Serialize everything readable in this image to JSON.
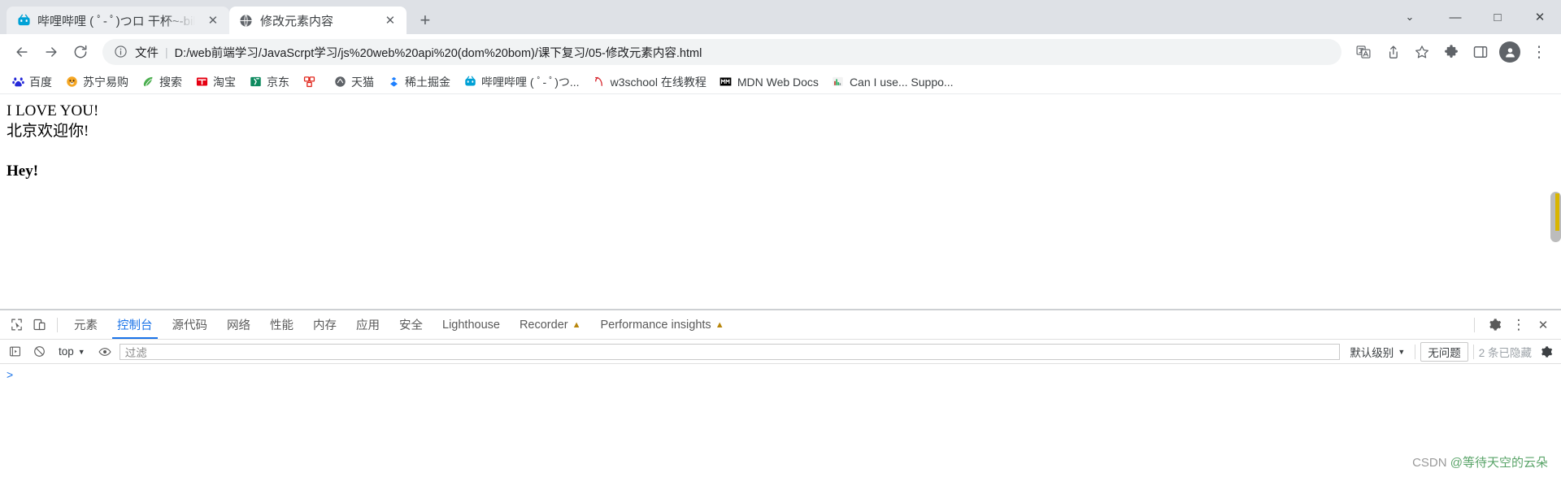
{
  "browser": {
    "tabs": [
      {
        "title": "哔哩哔哩 ( ﾟ- ﾟ)つロ 干杯~-bili",
        "favicon": "bilibili-icon",
        "active": false,
        "close_label": "✕"
      },
      {
        "title": "修改元素内容",
        "favicon": "globe-icon",
        "active": true,
        "close_label": "✕"
      }
    ],
    "new_tab_label": "+",
    "window_controls": {
      "chevron_label": "⌄",
      "minimize_label": "—",
      "maximize_label": "□",
      "close_label": "✕"
    },
    "toolbar": {
      "back_label": "←",
      "forward_label": "→",
      "reload_label": "⟳",
      "scheme_label": "文件",
      "separator": "|",
      "url": "D:/web前端学习/JavaScrpt学习/js%20web%20api%20(dom%20bom)/课下复习/05-修改元素内容.html",
      "translate_label": "translate-icon",
      "share_label": "share-icon",
      "bookmark_label": "star-icon",
      "extensions_label": "puzzle-icon",
      "sidepanel_label": "sidepanel-icon",
      "profile_label": "avatar",
      "menu_label": "⋮"
    },
    "bookmarks": [
      {
        "label": "百度",
        "icon": "baidu-icon"
      },
      {
        "label": "苏宁易购",
        "icon": "suning-icon"
      },
      {
        "label": "搜索",
        "icon": "sogou-icon"
      },
      {
        "label": "淘宝",
        "icon": "taobao-icon"
      },
      {
        "label": "京东",
        "icon": "jd-icon"
      },
      {
        "label": "",
        "icon": "pinpin-icon"
      },
      {
        "label": "天猫",
        "icon": "tmall-icon"
      },
      {
        "label": "稀土掘金",
        "icon": "juejin-icon"
      },
      {
        "label": "哔哩哔哩 ( ﾟ- ﾟ)つ...",
        "icon": "bilibili-icon"
      },
      {
        "label": "w3school 在线教程",
        "icon": "w3school-icon"
      },
      {
        "label": "MDN Web Docs",
        "icon": "mdn-icon"
      },
      {
        "label": "Can I use... Suppo...",
        "icon": "caniuse-icon"
      }
    ]
  },
  "page": {
    "line1": "I LOVE YOU!",
    "line2": "北京欢迎你!",
    "heading": "Hey!"
  },
  "devtools": {
    "inspect_icon": "inspect-icon",
    "device_icon": "device-toolbar-icon",
    "tabs": [
      {
        "label": "元素",
        "selected": false,
        "warn": false
      },
      {
        "label": "控制台",
        "selected": true,
        "warn": false
      },
      {
        "label": "源代码",
        "selected": false,
        "warn": false
      },
      {
        "label": "网络",
        "selected": false,
        "warn": false
      },
      {
        "label": "性能",
        "selected": false,
        "warn": false
      },
      {
        "label": "内存",
        "selected": false,
        "warn": false
      },
      {
        "label": "应用",
        "selected": false,
        "warn": false
      },
      {
        "label": "安全",
        "selected": false,
        "warn": false
      },
      {
        "label": "Lighthouse",
        "selected": false,
        "warn": false
      },
      {
        "label": "Recorder",
        "selected": false,
        "warn": true,
        "warn_glyph": "▲"
      },
      {
        "label": "Performance insights",
        "selected": false,
        "warn": true,
        "warn_glyph": "▲"
      }
    ],
    "settings_icon": "gear-icon",
    "more_icon": "⋮",
    "close_icon": "✕",
    "console": {
      "execute_icon": "execute-icon",
      "clear_icon": "clear-console-icon",
      "context": "top",
      "context_caret": "▼",
      "eye_icon": "eye-icon",
      "filter_placeholder": "过滤",
      "filter_value": "",
      "level": "默认级别",
      "level_caret": "▼",
      "issues_label": "无问题",
      "hidden_label": "2 条已隐藏",
      "settings_icon": "gear-icon",
      "prompt_caret": ">"
    }
  },
  "watermark": {
    "prefix": "CSDN ",
    "author": "@等待天空的云朵"
  }
}
